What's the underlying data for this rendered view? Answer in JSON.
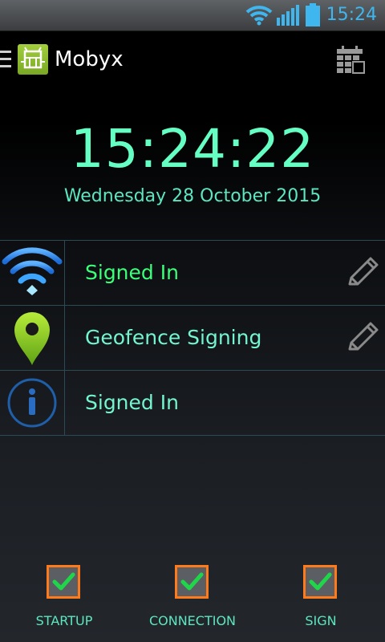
{
  "status_bar": {
    "time": "15:24",
    "icons": [
      "wifi-icon",
      "signal-icon",
      "battery-icon"
    ],
    "accent_color": "#40b6ee"
  },
  "action_bar": {
    "title": "Mobyx",
    "icons": [
      "menu-icon",
      "app-logo",
      "calendar-icon"
    ]
  },
  "clock": {
    "time": "15:24:22",
    "date": "Wednesday 28 October 2015",
    "color": "#65ffc4"
  },
  "status_list": [
    {
      "icon": "wifi-icon",
      "label": "Signed In",
      "label_color": "#3cff7a",
      "editable": true
    },
    {
      "icon": "map-pin-icon",
      "label": "Geofence Signing",
      "label_color": "#74f5d0",
      "editable": true
    },
    {
      "icon": "info-icon",
      "label": "Signed In",
      "label_color": "#74f5d0",
      "editable": false
    }
  ],
  "bottom_bar": [
    {
      "label": "STARTUP",
      "checked": true
    },
    {
      "label": "CONNECTION",
      "checked": true
    },
    {
      "label": "SIGN",
      "checked": true
    }
  ]
}
